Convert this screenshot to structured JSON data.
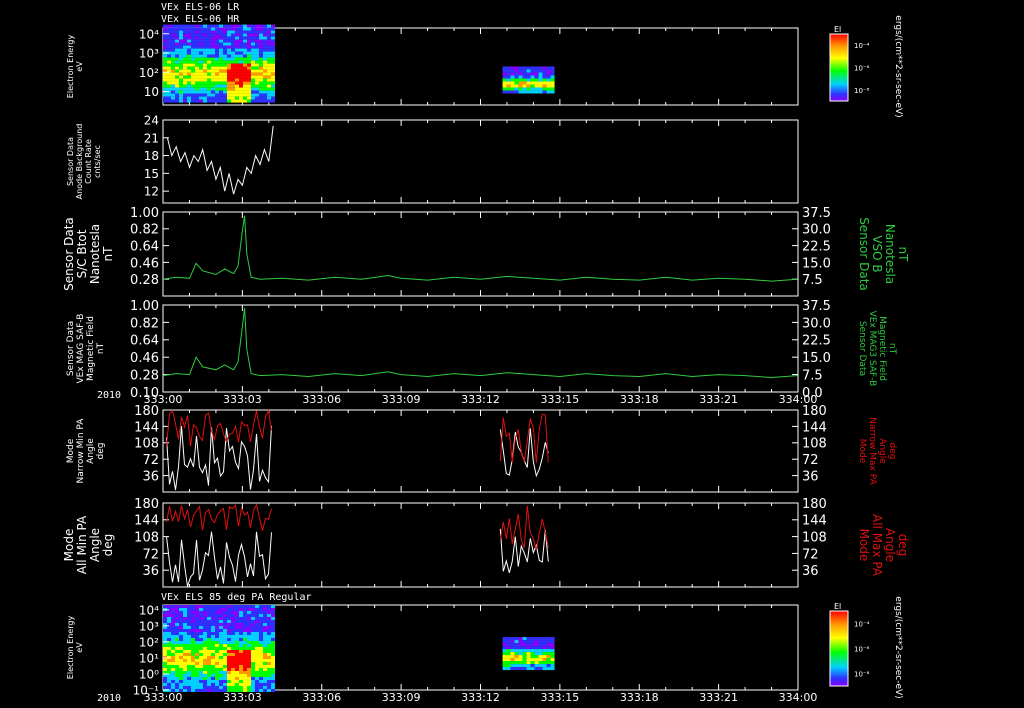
{
  "page": {
    "header_lines": [
      "VEx ELS-06 LR",
      "VEx ELS-06 HR"
    ],
    "bottom_panel_title": "VEx ELS 85 deg PA Regular",
    "year_label": "2010"
  },
  "colors": {
    "background": "#000000",
    "axis": "#ffffff",
    "trace_white": "#ffffff",
    "trace_green": "#2ecc40",
    "trace_red": "#e01010"
  },
  "chart_data": [
    {
      "id": "panel-electron-energy-top",
      "type": "heatmap",
      "ylabel": [
        "Electron Energy",
        "eV"
      ],
      "y_scale": "log",
      "y_ticks": [
        "10⁴",
        "10³",
        "10²",
        "10"
      ],
      "y_tick_values": [
        10000,
        1000,
        100,
        10
      ],
      "colorbar": {
        "label": "El",
        "ticks": [
          "10⁻⁴",
          "10⁻⁶",
          "10⁻⁸"
        ],
        "units": "ergs/(cm**2-sr-sec-eV)"
      },
      "blocks": [
        {
          "t_start": "333:00",
          "t_end": "333:04:10",
          "energy_range_eV": [
            3,
            30000
          ]
        },
        {
          "t_start": "333:12:50",
          "t_end": "333:14:45",
          "energy_range_eV": [
            8,
            200
          ]
        }
      ]
    },
    {
      "id": "panel-background",
      "type": "line",
      "ylabel": [
        "Sensor Data",
        "Anode Background",
        "Count Rate",
        "cnts/sec"
      ],
      "y_ticks": [
        "24",
        "21",
        "18",
        "15",
        "12"
      ],
      "ylim": [
        10,
        24
      ],
      "series": [
        {
          "color": "trace_white",
          "x": [
            "333:00:10",
            "333:00:20",
            "333:00:30",
            "333:00:40",
            "333:00:50",
            "333:01:00",
            "333:01:10",
            "333:01:20",
            "333:01:30",
            "333:01:40",
            "333:01:50",
            "333:02:00",
            "333:02:10",
            "333:02:20",
            "333:02:30",
            "333:02:40",
            "333:02:50",
            "333:03:00",
            "333:03:10",
            "333:03:20",
            "333:03:30",
            "333:03:40",
            "333:03:50",
            "333:04:00",
            "333:04:10"
          ],
          "values": [
            21,
            18,
            19.5,
            17,
            18.5,
            16,
            18,
            17,
            19,
            15.5,
            17,
            14,
            16,
            12,
            15,
            11.5,
            14,
            13,
            16,
            15,
            18,
            16.5,
            19,
            17,
            23
          ]
        }
      ]
    },
    {
      "id": "panel-sc-btot",
      "type": "line",
      "ylabel": [
        "Sensor Data",
        "S/C Btot",
        "Nanotesla",
        "nT"
      ],
      "y_ticks": [
        "1.00",
        "0.82",
        "0.64",
        "0.46",
        "0.28"
      ],
      "ylim": [
        0.1,
        1.0
      ],
      "y2label": [
        "Sensor Data",
        "VSO B",
        "Nanotesla",
        "nT"
      ],
      "y2_ticks": [
        "37.5",
        "30.0",
        "22.5",
        "15.0",
        "7.5"
      ],
      "series": [
        {
          "color": "trace_green",
          "x": [
            "333:00:00",
            "333:00:30",
            "333:01:00",
            "333:01:15",
            "333:01:30",
            "333:02:00",
            "333:02:20",
            "333:02:40",
            "333:02:50",
            "333:03:00",
            "333:03:05",
            "333:03:10",
            "333:03:20",
            "333:03:40",
            "333:04:30",
            "333:05:30",
            "333:06:30",
            "333:07:30",
            "333:08:30",
            "333:09:00",
            "333:10:00",
            "333:11:00",
            "333:12:00",
            "333:13:00",
            "333:14:00",
            "333:15:00",
            "333:16:00",
            "333:17:00",
            "333:18:00",
            "333:19:00",
            "333:20:00",
            "333:21:00",
            "333:22:00",
            "333:23:00",
            "333:23:59"
          ],
          "values": [
            0.28,
            0.3,
            0.29,
            0.45,
            0.37,
            0.33,
            0.39,
            0.34,
            0.42,
            0.8,
            0.96,
            0.55,
            0.3,
            0.28,
            0.29,
            0.27,
            0.3,
            0.28,
            0.32,
            0.29,
            0.27,
            0.3,
            0.28,
            0.31,
            0.29,
            0.27,
            0.3,
            0.28,
            0.27,
            0.3,
            0.27,
            0.29,
            0.28,
            0.26,
            0.28
          ]
        }
      ]
    },
    {
      "id": "panel-mag-saf",
      "type": "line",
      "ylabel": [
        "Sensor Data",
        "VEx MAG SAF-B",
        "Magnetic Field",
        "nT"
      ],
      "y_ticks": [
        "1.00",
        "0.82",
        "0.64",
        "0.46",
        "0.28",
        "0.10"
      ],
      "ylim": [
        0.1,
        1.0
      ],
      "y2label": [
        "Sensor Data",
        "VEx MAG3 SAF-B",
        "Magnetic Field",
        "nT"
      ],
      "y2_ticks": [
        "37.5",
        "30.0",
        "22.5",
        "15.0",
        "7.5",
        "0.0"
      ],
      "x_ticks": [
        "333:00",
        "333:03",
        "333:06",
        "333:09",
        "333:12",
        "333:15",
        "333:18",
        "333:21",
        "334:00"
      ],
      "series": [
        {
          "color": "trace_green",
          "x": [
            "333:00:00",
            "333:00:30",
            "333:01:00",
            "333:01:15",
            "333:01:30",
            "333:02:00",
            "333:02:20",
            "333:02:40",
            "333:02:50",
            "333:03:00",
            "333:03:05",
            "333:03:10",
            "333:03:20",
            "333:03:40",
            "333:04:30",
            "333:05:30",
            "333:06:30",
            "333:07:30",
            "333:08:30",
            "333:09:00",
            "333:10:00",
            "333:11:00",
            "333:12:00",
            "333:13:00",
            "333:14:00",
            "333:15:00",
            "333:16:00",
            "333:17:00",
            "333:18:00",
            "333:19:00",
            "333:20:00",
            "333:21:00",
            "333:22:00",
            "333:23:00",
            "333:23:59"
          ],
          "values": [
            0.27,
            0.29,
            0.28,
            0.46,
            0.36,
            0.33,
            0.38,
            0.33,
            0.41,
            0.78,
            0.97,
            0.54,
            0.29,
            0.27,
            0.28,
            0.26,
            0.29,
            0.27,
            0.31,
            0.28,
            0.26,
            0.29,
            0.27,
            0.3,
            0.28,
            0.26,
            0.29,
            0.27,
            0.26,
            0.29,
            0.26,
            0.28,
            0.27,
            0.25,
            0.27
          ]
        }
      ]
    },
    {
      "id": "panel-narrow-pa",
      "type": "line",
      "ylabel": [
        "Mode",
        "Narrow Min PA",
        "Angle",
        "deg"
      ],
      "y2label": [
        "Mode",
        "Narrow Max PA",
        "Angle",
        "deg"
      ],
      "y_ticks": [
        "180",
        "144",
        "108",
        "72",
        "36"
      ],
      "y2_ticks": [
        "180",
        "144",
        "108",
        "72",
        "36"
      ],
      "ylim": [
        0,
        180
      ],
      "segments": [
        {
          "t_start": "333:00:08",
          "t_end": "333:04:10",
          "max_range": [
            120,
            180
          ],
          "min_range": [
            0,
            110
          ]
        },
        {
          "t_start": "333:12:45",
          "t_end": "333:14:40",
          "max_range": [
            80,
            180
          ],
          "min_range": [
            20,
            100
          ]
        }
      ]
    },
    {
      "id": "panel-all-pa",
      "type": "line",
      "ylabel": [
        "Mode",
        "All Min PA",
        "Angle",
        "deg"
      ],
      "y2label": [
        "Mode",
        "All Max PA",
        "Angle",
        "deg"
      ],
      "y_ticks": [
        "180",
        "144",
        "108",
        "72",
        "36"
      ],
      "y2_ticks": [
        "180",
        "144",
        "108",
        "72",
        "36"
      ],
      "ylim": [
        0,
        180
      ],
      "segments": [
        {
          "t_start": "333:00:08",
          "t_end": "333:04:10",
          "max_range": [
            140,
            180
          ],
          "min_range": [
            0,
            80
          ]
        },
        {
          "t_start": "333:12:45",
          "t_end": "333:14:40",
          "max_range": [
            100,
            180
          ],
          "min_range": [
            30,
            90
          ]
        }
      ]
    },
    {
      "id": "panel-electron-energy-bottom",
      "type": "heatmap",
      "ylabel": [
        "Electron Energy",
        "eV"
      ],
      "y_scale": "log",
      "y_ticks": [
        "10⁴",
        "10³",
        "10²",
        "10¹",
        "10⁰",
        "10⁻¹"
      ],
      "y_tick_values": [
        10000,
        1000,
        100,
        10,
        1,
        0.1
      ],
      "x_ticks": [
        "333:00",
        "333:03",
        "333:06",
        "333:09",
        "333:12",
        "333:15",
        "333:18",
        "333:21",
        "334:00"
      ],
      "colorbar": {
        "label": "El",
        "ticks": [
          "10⁻⁴",
          "10⁻⁶",
          "10⁻⁸"
        ],
        "units": "ergs/(cm**2-sr-sec-eV)"
      },
      "blocks": [
        {
          "t_start": "333:00",
          "t_end": "333:04:10",
          "energy_range_eV": [
            0.1,
            20000
          ]
        },
        {
          "t_start": "333:12:50",
          "t_end": "333:14:45",
          "energy_range_eV": [
            2,
            200
          ]
        }
      ]
    }
  ]
}
